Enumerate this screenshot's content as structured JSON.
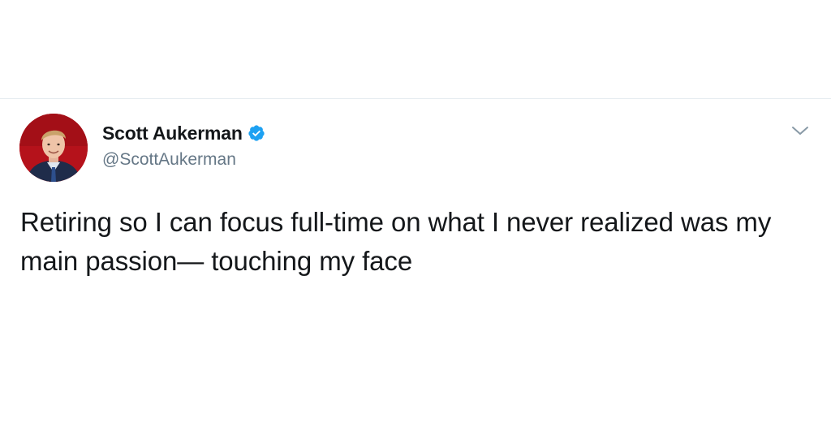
{
  "tweet": {
    "author": {
      "display_name": "Scott Aukerman",
      "handle": "@ScottAukerman",
      "verified": true,
      "verified_icon": "verified-badge-icon",
      "avatar_icon": "profile-photo"
    },
    "menu_icon": "chevron-down-icon",
    "text": "Retiring so I can focus full-time on what I never realized was my main passion— touching my face"
  },
  "colors": {
    "text_primary": "#14171a",
    "text_secondary": "#657786",
    "verified_blue": "#1da1f2",
    "divider": "#e6ecf0",
    "avatar_background": "#b5121b"
  }
}
